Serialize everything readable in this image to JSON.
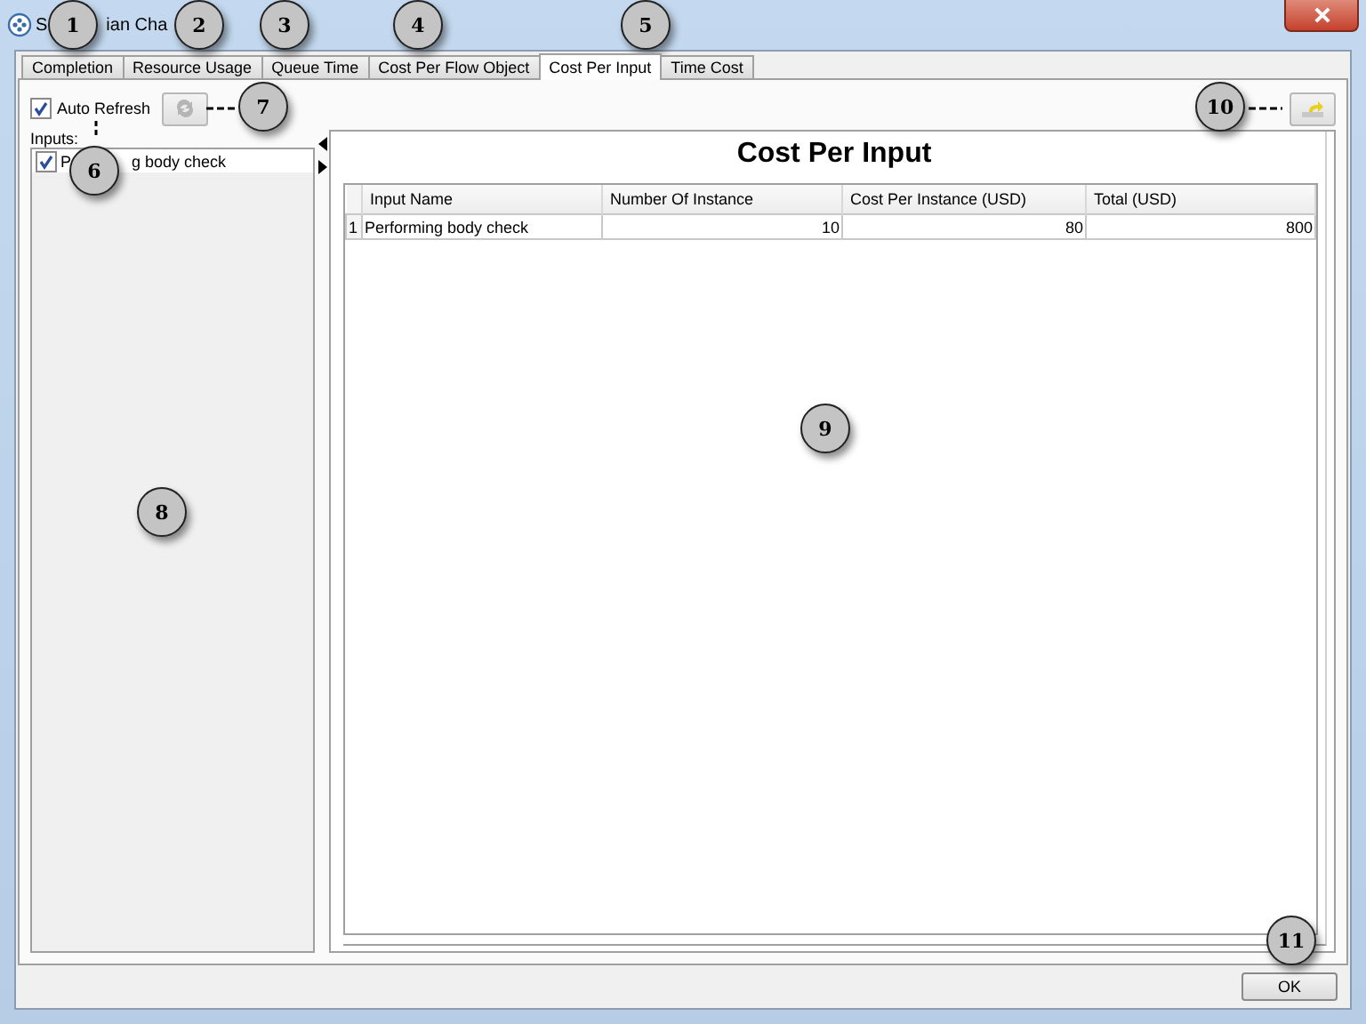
{
  "window": {
    "title_parts": [
      "S",
      "ian Cha"
    ]
  },
  "tabs": [
    {
      "label": "Completion",
      "selected": false
    },
    {
      "label": "Resource Usage",
      "selected": false
    },
    {
      "label": "Queue Time",
      "selected": false
    },
    {
      "label": "Cost Per Flow Object",
      "selected": false
    },
    {
      "label": "Cost Per Input",
      "selected": true
    },
    {
      "label": "Time Cost",
      "selected": false
    }
  ],
  "auto_refresh": {
    "label": "Auto Refresh",
    "checked": true
  },
  "inputs": {
    "label": "Inputs:",
    "items": [
      {
        "label_parts": [
          "P",
          "g body check"
        ],
        "checked": true
      }
    ]
  },
  "report": {
    "title": "Cost Per Input",
    "columns": [
      "Input Name",
      "Number Of Instance",
      "Cost Per Instance (USD)",
      "Total (USD)"
    ],
    "rows": [
      {
        "index": "1",
        "cells": [
          "Performing body check",
          "10",
          "80",
          "800"
        ]
      }
    ]
  },
  "buttons": [
    "OK"
  ],
  "callouts": [
    "1",
    "2",
    "3",
    "4",
    "5",
    "6",
    "7",
    "8",
    "9",
    "10",
    "11"
  ]
}
